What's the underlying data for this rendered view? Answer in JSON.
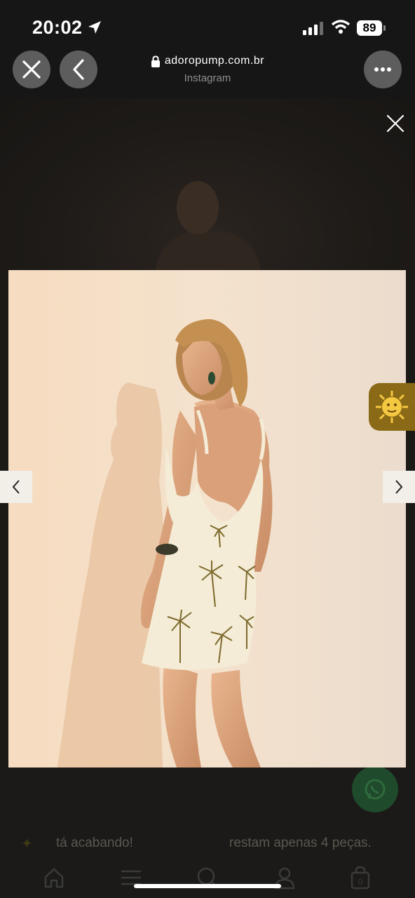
{
  "status_bar": {
    "time": "20:02",
    "battery": "89"
  },
  "browser": {
    "url": "adoropump.com.br",
    "source": "Instagram"
  },
  "promo": {
    "left_text": "tá acabando!",
    "right_text": "restam apenas 4 peças."
  },
  "icons": {
    "close": "close-icon",
    "back": "chevron-left-icon",
    "more": "more-icon",
    "lock": "lock-icon",
    "lightbox_close": "close-icon",
    "prev": "chevron-left-icon",
    "next": "chevron-right-icon",
    "sun": "sun-icon",
    "whatsapp": "whatsapp-icon",
    "nav": [
      "home-icon",
      "menu-icon",
      "search-icon",
      "user-icon",
      "bag-icon"
    ]
  },
  "cart_count": "0",
  "colors": {
    "overlay": "#161616",
    "backdrop": "#f3dcc0",
    "badge": "#8b6a17"
  }
}
